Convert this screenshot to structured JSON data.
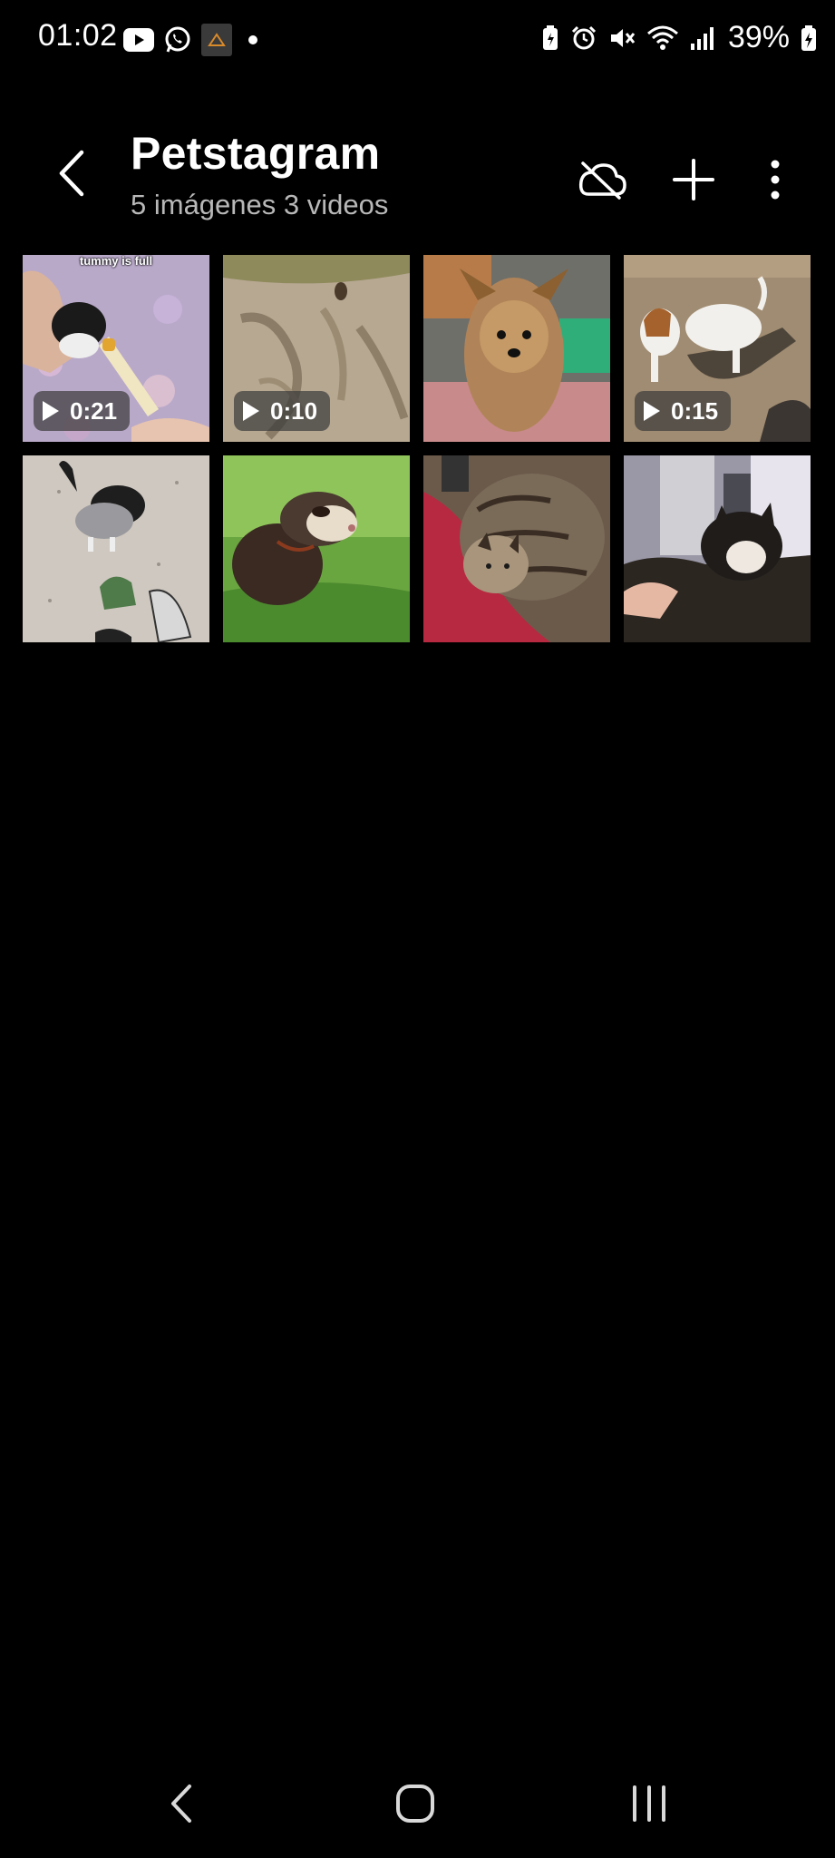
{
  "status_bar": {
    "time": "01:02",
    "battery_percent": "39%",
    "notification_icons": [
      "youtube-icon",
      "whatsapp-icon",
      "app-thumbnail-icon",
      "dot-icon"
    ],
    "system_icons": [
      "battery-saver-icon",
      "alarm-icon",
      "mute-icon",
      "wifi-icon",
      "signal-icon",
      "battery-charging-icon"
    ]
  },
  "header": {
    "title": "Petstagram",
    "subtitle": "5 imágenes 3 videos",
    "actions": [
      "cloud-off-icon",
      "add-icon",
      "more-options-icon"
    ]
  },
  "grid": {
    "items": [
      {
        "type": "video",
        "duration": "0:21",
        "caption": "tummy is full",
        "subject": "kitten-bottle-feeding"
      },
      {
        "type": "video",
        "duration": "0:10",
        "subject": "small-dog-on-dirt-path"
      },
      {
        "type": "video",
        "duration": "",
        "subject": "yorkshire-terrier"
      },
      {
        "type": "video",
        "duration": "0:15",
        "subject": "jack-russell-terrier"
      },
      {
        "type": "image",
        "subject": "puppy-in-sweater"
      },
      {
        "type": "image",
        "subject": "ferret-on-grass"
      },
      {
        "type": "image",
        "subject": "tabby-cat-sleeping"
      },
      {
        "type": "image",
        "subject": "cat-on-lap"
      }
    ]
  },
  "nav_bar": {
    "buttons": [
      "back-nav-icon",
      "home-nav-icon",
      "recents-nav-icon"
    ]
  },
  "colors": {
    "background": "#000000",
    "text_primary": "#ffffff",
    "text_secondary": "#b8b8b8",
    "badge_bg": "rgba(60,60,60,0.72)"
  }
}
